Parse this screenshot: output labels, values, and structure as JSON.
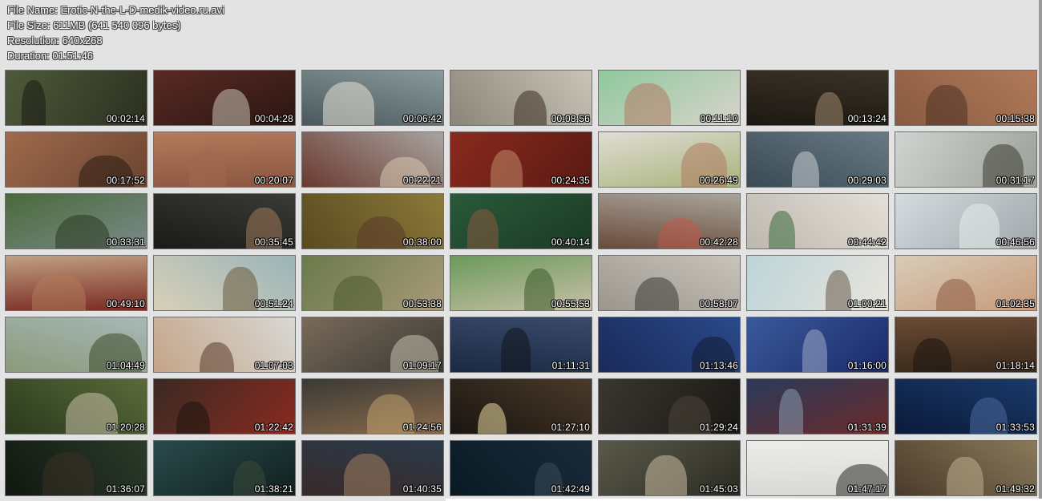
{
  "header": {
    "file_name_label": "File Name:",
    "file_name": "Erotic-N-the-L-D-medik-video.ru.avi",
    "file_size_label": "File Size:",
    "file_size": "611MB (641 540 096 bytes)",
    "resolution_label": "Resolution:",
    "resolution": "640x268",
    "duration_label": "Duration:",
    "duration": "01:51:46"
  },
  "thumbnails": [
    {
      "time": "00:02:14",
      "c1": "#4f5a3a",
      "c2": "#2a3020",
      "fig": "#1a1a14"
    },
    {
      "time": "00:04:28",
      "c1": "#5a2a24",
      "c2": "#2b1612",
      "fig": "#c9c2b5"
    },
    {
      "time": "00:06:42",
      "c1": "#8a9a9c",
      "c2": "#4a5a5c",
      "fig": "#e8e2d6"
    },
    {
      "time": "00:08:56",
      "c1": "#c9c4b8",
      "c2": "#8a8578",
      "fig": "#3a2c22"
    },
    {
      "time": "00:11:10",
      "c1": "#8fc89c",
      "c2": "#d8d4cc",
      "fig": "#b07a62"
    },
    {
      "time": "00:13:24",
      "c1": "#3a3226",
      "c2": "#1c1812",
      "fig": "#a08a70"
    },
    {
      "time": "00:15:38",
      "c1": "#b07a5a",
      "c2": "#8a5a40",
      "fig": "#4a3224"
    },
    {
      "time": "00:17:52",
      "c1": "#a06a4c",
      "c2": "#6a4430",
      "fig": "#2a1a12"
    },
    {
      "time": "00:20:07",
      "c1": "#b47a5c",
      "c2": "#8a5640",
      "fig": "#a06a50"
    },
    {
      "time": "00:22:21",
      "c1": "#a8a4a0",
      "c2": "#6a3a30",
      "fig": "#d8c8b0"
    },
    {
      "time": "00:24:35",
      "c1": "#8a2a1e",
      "c2": "#5a1a12",
      "fig": "#c08a6a"
    },
    {
      "time": "00:26:49",
      "c1": "#e0dcd4",
      "c2": "#a8b47a",
      "fig": "#b07a60"
    },
    {
      "time": "00:29:03",
      "c1": "#6a7a84",
      "c2": "#3a4a54",
      "fig": "#c8d0d4"
    },
    {
      "time": "00:31:17",
      "c1": "#d0d4d0",
      "c2": "#9aa098",
      "fig": "#3a3a30"
    },
    {
      "time": "00:33:31",
      "c1": "#4a6a3a",
      "c2": "#7a8a8a",
      "fig": "#2a3a20"
    },
    {
      "time": "00:35:45",
      "c1": "#3a3a36",
      "c2": "#1a1a18",
      "fig": "#a07a5a"
    },
    {
      "time": "00:38:00",
      "c1": "#8a7a3a",
      "c2": "#5a4a20",
      "fig": "#5a3a2a"
    },
    {
      "time": "00:40:14",
      "c1": "#2a5a3a",
      "c2": "#1a3a24",
      "fig": "#8a5a40"
    },
    {
      "time": "00:42:28",
      "c1": "#a8a49a",
      "c2": "#6a4a3a",
      "fig": "#c05a4a"
    },
    {
      "time": "00:44:42",
      "c1": "#e4e0d8",
      "c2": "#bcb8b0",
      "fig": "#3a6a3a"
    },
    {
      "time": "00:46:56",
      "c1": "#d4dce0",
      "c2": "#a0a8ac",
      "fig": "#e8ecec"
    },
    {
      "time": "00:49:10",
      "c1": "#c0a080",
      "c2": "#7a2a24",
      "fig": "#b07a5a"
    },
    {
      "time": "00:51:24",
      "c1": "#9ab4b8",
      "c2": "#d8d0b8",
      "fig": "#6a5a3a"
    },
    {
      "time": "00:53:38",
      "c1": "#6a7a4a",
      "c2": "#a89a7a",
      "fig": "#4a5a2a"
    },
    {
      "time": "00:55:53",
      "c1": "#6a9a5a",
      "c2": "#c8c0a8",
      "fig": "#3a5a2a"
    },
    {
      "time": "00:58:07",
      "c1": "#c8c4bc",
      "c2": "#9a968e",
      "fig": "#3a3a36"
    },
    {
      "time": "01:00:21",
      "c1": "#bcd4d8",
      "c2": "#e8e4dc",
      "fig": "#6a5a4a"
    },
    {
      "time": "01:02:35",
      "c1": "#d8ccb8",
      "c2": "#c89a7a",
      "fig": "#8a5a40"
    },
    {
      "time": "01:04:49",
      "c1": "#a8b8b8",
      "c2": "#8a9a7a",
      "fig": "#3a4a2a"
    },
    {
      "time": "01:07:03",
      "c1": "#d8d8d4",
      "c2": "#c4a488",
      "fig": "#5a3a2a"
    },
    {
      "time": "01:09:17",
      "c1": "#7a6a5a",
      "c2": "#3a3a34",
      "fig": "#c8c0b0"
    },
    {
      "time": "01:11:31",
      "c1": "#3a4a6a",
      "c2": "#1a2a44",
      "fig": "#101418"
    },
    {
      "time": "01:13:46",
      "c1": "#2a4a8a",
      "c2": "#1a2a5a",
      "fig": "#101a30"
    },
    {
      "time": "01:16:00",
      "c1": "#3a5a9a",
      "c2": "#1a2a6a",
      "fig": "#a0a8c8"
    },
    {
      "time": "01:18:14",
      "c1": "#6a4a34",
      "c2": "#3a2a1c",
      "fig": "#1a1410"
    },
    {
      "time": "01:20:28",
      "c1": "#5a6a3a",
      "c2": "#2a3a1c",
      "fig": "#c8c0a8"
    },
    {
      "time": "01:22:42",
      "c1": "#3a2a22",
      "c2": "#8a2a20",
      "fig": "#1a1410"
    },
    {
      "time": "01:24:56",
      "c1": "#3a3a36",
      "c2": "#8a6a4a",
      "fig": "#c0a070"
    },
    {
      "time": "01:27:10",
      "c1": "#4a3a2a",
      "c2": "#1a1410",
      "fig": "#e8d8a0"
    },
    {
      "time": "01:29:24",
      "c1": "#3a3630",
      "c2": "#1a1814",
      "fig": "#4a4438"
    },
    {
      "time": "01:31:39",
      "c1": "#2a3a5a",
      "c2": "#6a2a2a",
      "fig": "#8a9ab0"
    },
    {
      "time": "01:33:53",
      "c1": "#1a3a6a",
      "c2": "#0a1a3a",
      "fig": "#4a6a9a"
    },
    {
      "time": "01:36:07",
      "c1": "#2a3a2a",
      "c2": "#101810",
      "fig": "#3a3024"
    },
    {
      "time": "01:38:21",
      "c1": "#2a4a4a",
      "c2": "#102020",
      "fig": "#3a4a3a"
    },
    {
      "time": "01:40:35",
      "c1": "#2a3a4a",
      "c2": "#3a2a2a",
      "fig": "#a08060"
    },
    {
      "time": "01:42:49",
      "c1": "#1a2a3a",
      "c2": "#0a1a24",
      "fig": "#3a4a5a"
    },
    {
      "time": "01:45:03",
      "c1": "#5a5a4a",
      "c2": "#2a2a22",
      "fig": "#c8bca0"
    },
    {
      "time": "01:47:17",
      "c1": "#ecece8",
      "c2": "#d8d8d4",
      "fig": "#2a2a28"
    },
    {
      "time": "01:49:32",
      "c1": "#8a7a5a",
      "c2": "#4a3a2a",
      "fig": "#c0b090"
    }
  ]
}
